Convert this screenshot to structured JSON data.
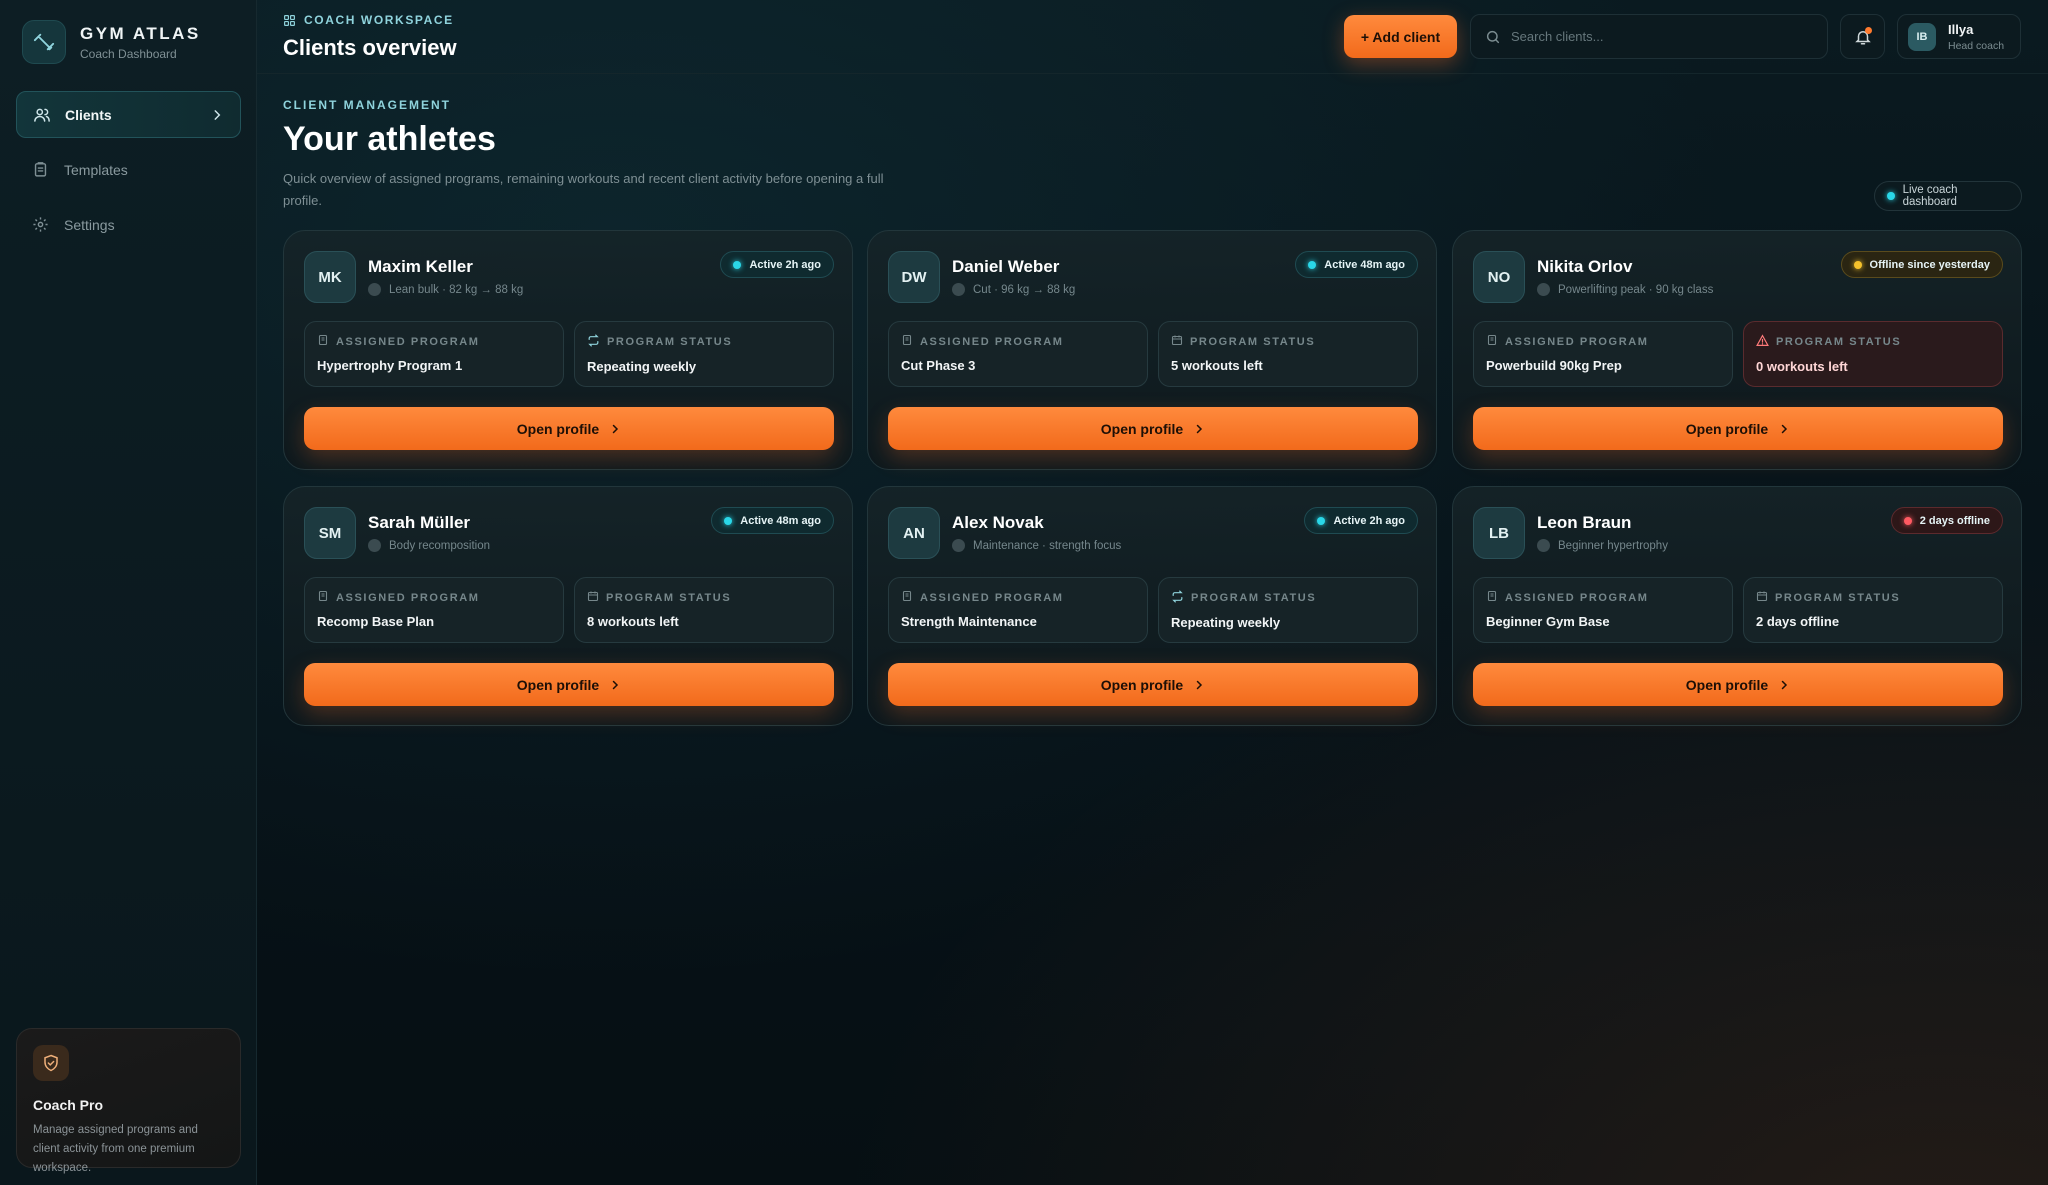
{
  "brand": {
    "title": "GYM ATLAS",
    "subtitle": "Coach Dashboard"
  },
  "sidebar": {
    "items": [
      {
        "label": "Clients",
        "icon": "users-icon",
        "active": true
      },
      {
        "label": "Templates",
        "icon": "clipboard-icon",
        "active": false
      },
      {
        "label": "Settings",
        "icon": "gear-icon",
        "active": false
      }
    ],
    "promo": {
      "title": "Coach Pro",
      "text": "Manage assigned programs and client activity from one premium workspace."
    }
  },
  "header": {
    "crumb": "COACH WORKSPACE",
    "title": "Clients overview",
    "add_label": "+ Add client",
    "search_placeholder": "Search clients...",
    "user": {
      "initials": "IB",
      "name": "Illya",
      "role": "Head coach"
    }
  },
  "main": {
    "section_label": "CLIENT MANAGEMENT",
    "title": "Your athletes",
    "description": "Quick overview of assigned programs, remaining workouts and recent client activity before opening a full profile.",
    "live_label": "Live coach dashboard",
    "assigned_label": "ASSIGNED PROGRAM",
    "status_label": "PROGRAM STATUS",
    "open_label": "Open profile"
  },
  "clients": [
    {
      "initials": "MK",
      "name": "Maxim Keller",
      "goal": "Lean bulk · 82 kg → 88 kg",
      "badge": "Active 2h ago",
      "badge_type": "active",
      "program": "Hypertrophy Program 1",
      "status": "Repeating weekly",
      "status_icon": "repeat-icon",
      "status_alert": false
    },
    {
      "initials": "DW",
      "name": "Daniel Weber",
      "goal": "Cut · 96 kg → 88 kg",
      "badge": "Active 48m ago",
      "badge_type": "active",
      "program": "Cut Phase 3",
      "status": "5 workouts left",
      "status_icon": "calendar-icon",
      "status_alert": false
    },
    {
      "initials": "NO",
      "name": "Nikita Orlov",
      "goal": "Powerlifting peak · 90 kg class",
      "badge": "Offline since yesterday",
      "badge_type": "warn",
      "program": "Powerbuild 90kg Prep",
      "status": "0 workouts left",
      "status_icon": "warning-icon",
      "status_alert": true
    },
    {
      "initials": "SM",
      "name": "Sarah Müller",
      "goal": "Body recomposition",
      "badge": "Active 48m ago",
      "badge_type": "active",
      "program": "Recomp Base Plan",
      "status": "8 workouts left",
      "status_icon": "calendar-icon",
      "status_alert": false
    },
    {
      "initials": "AN",
      "name": "Alex Novak",
      "goal": "Maintenance · strength focus",
      "badge": "Active 2h ago",
      "badge_type": "active",
      "program": "Strength Maintenance",
      "status": "Repeating weekly",
      "status_icon": "repeat-icon",
      "status_alert": false
    },
    {
      "initials": "LB",
      "name": "Leon Braun",
      "goal": "Beginner hypertrophy",
      "badge": "2 days offline",
      "badge_type": "danger",
      "program": "Beginner Gym Base",
      "status": "2 days offline",
      "status_icon": "calendar-icon",
      "status_alert": false
    }
  ],
  "colors": {
    "accent": "#ff7a2e",
    "teal": "#2ad7e8",
    "warn": "#f5c22c",
    "danger": "#ff5a62"
  }
}
